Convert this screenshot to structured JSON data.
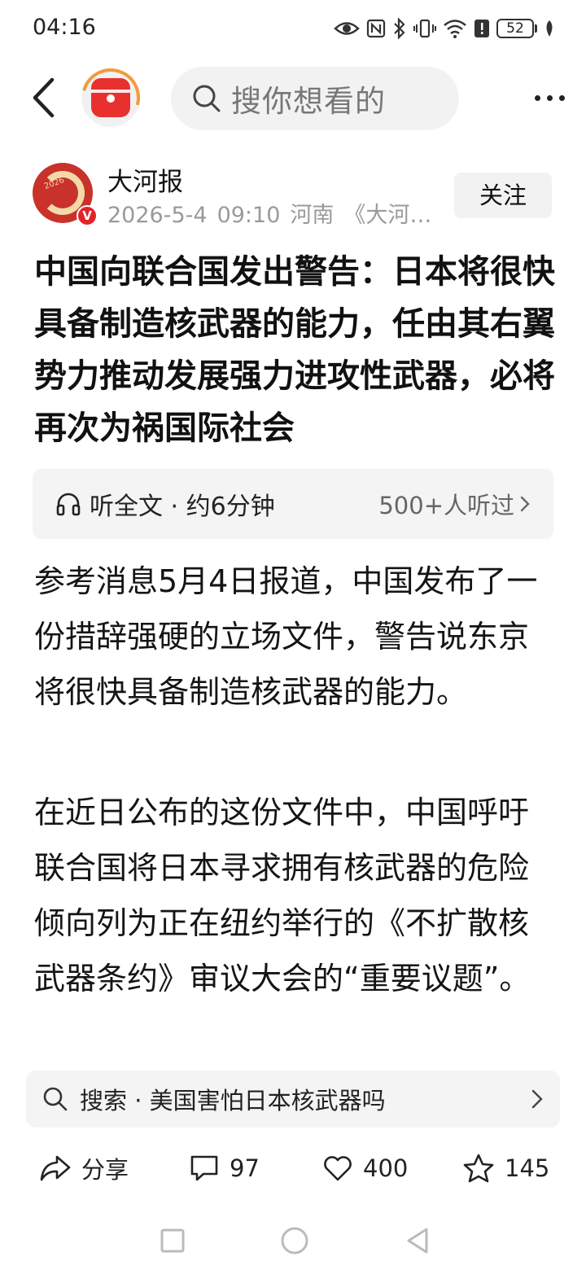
{
  "status_bar": {
    "time": "04:16",
    "battery": "52",
    "icons": [
      "eye-icon",
      "nfc-icon",
      "bluetooth-icon",
      "vibrate-icon",
      "wifi-icon",
      "alert-icon",
      "battery-icon",
      "leaf-icon"
    ]
  },
  "nav": {
    "search_placeholder": "搜你想看的",
    "icons": [
      "back-icon",
      "app-logo",
      "search-icon",
      "more-icon"
    ]
  },
  "author": {
    "name": "大河报",
    "date": "2026-5-4",
    "time": "09:10",
    "location": "河南",
    "source": "《大河…",
    "follow_label": "关注",
    "verified_label": "V",
    "avatar_year": "2026"
  },
  "article": {
    "title": "中国向联合国发出警告：日本将很快具备制造核武器的能力，任由其右翼势力推动发展强力进攻性武器，必将再次为祸国际社会",
    "paragraphs": [
      "参考消息5月4日报道，中国发布了一份措辞强硬的立场文件，警告说东京将很快具备制造核武器的能力。",
      "在近日公布的这份文件中，中国呼吁联合国将日本寻求拥有核武器的危险倾向列为正在纽约举行的《不扩散核武器条约》审议大会的“重要议题”。"
    ]
  },
  "listen": {
    "label": "听全文 · 约6分钟",
    "count": "500+人听过"
  },
  "suggestion": {
    "text": "搜索 · 美国害怕日本核武器吗"
  },
  "actions": {
    "share": "分享",
    "comments": "97",
    "likes": "400",
    "favorites": "145"
  },
  "colors": {
    "accent_red": "#e8312f",
    "logo_ring": "#f39a3a",
    "muted_text": "#9a9a9a",
    "panel_bg": "#f4f4f5"
  }
}
